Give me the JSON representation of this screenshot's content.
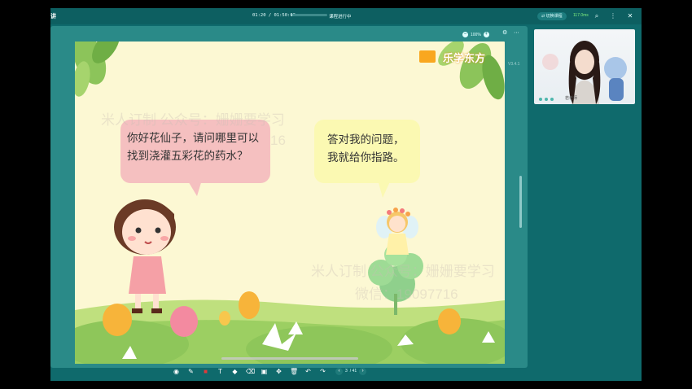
{
  "titlebar": {
    "left_label": "讲",
    "time_current": "01:20",
    "time_sep": "/",
    "time_total": "01:50:00",
    "progress_percent": 2,
    "status": "课程进行中",
    "switch_label": "切换课程",
    "signal": "117.0ms"
  },
  "panel": {
    "zoom_level": "100%",
    "version": "V3.4.1"
  },
  "slide": {
    "logo": "乐学东方",
    "bubble_left_line1": "你好花仙子，请问哪里可以",
    "bubble_left_line2": "找到浇灌五彩花的药水？",
    "bubble_right_line1": "答对我的问题，",
    "bubble_right_line2": "我就给你指路。",
    "watermark1": "米人订制 公众号：姗姗要学习",
    "watermark1_num": "16",
    "watermark2": "米人订制 公众号：姗姗要学习",
    "watermark3": "微信：19097716"
  },
  "pager": {
    "current": "3",
    "total": "/ 41"
  },
  "video": {
    "teacher": "若老师"
  },
  "colors": {
    "frame": "#0f6a6c",
    "panel": "#2a8a88",
    "slide_bg": "#fcf8d3",
    "bubble_left": "#f5c0c0",
    "bubble_right": "#fbf9b2"
  }
}
